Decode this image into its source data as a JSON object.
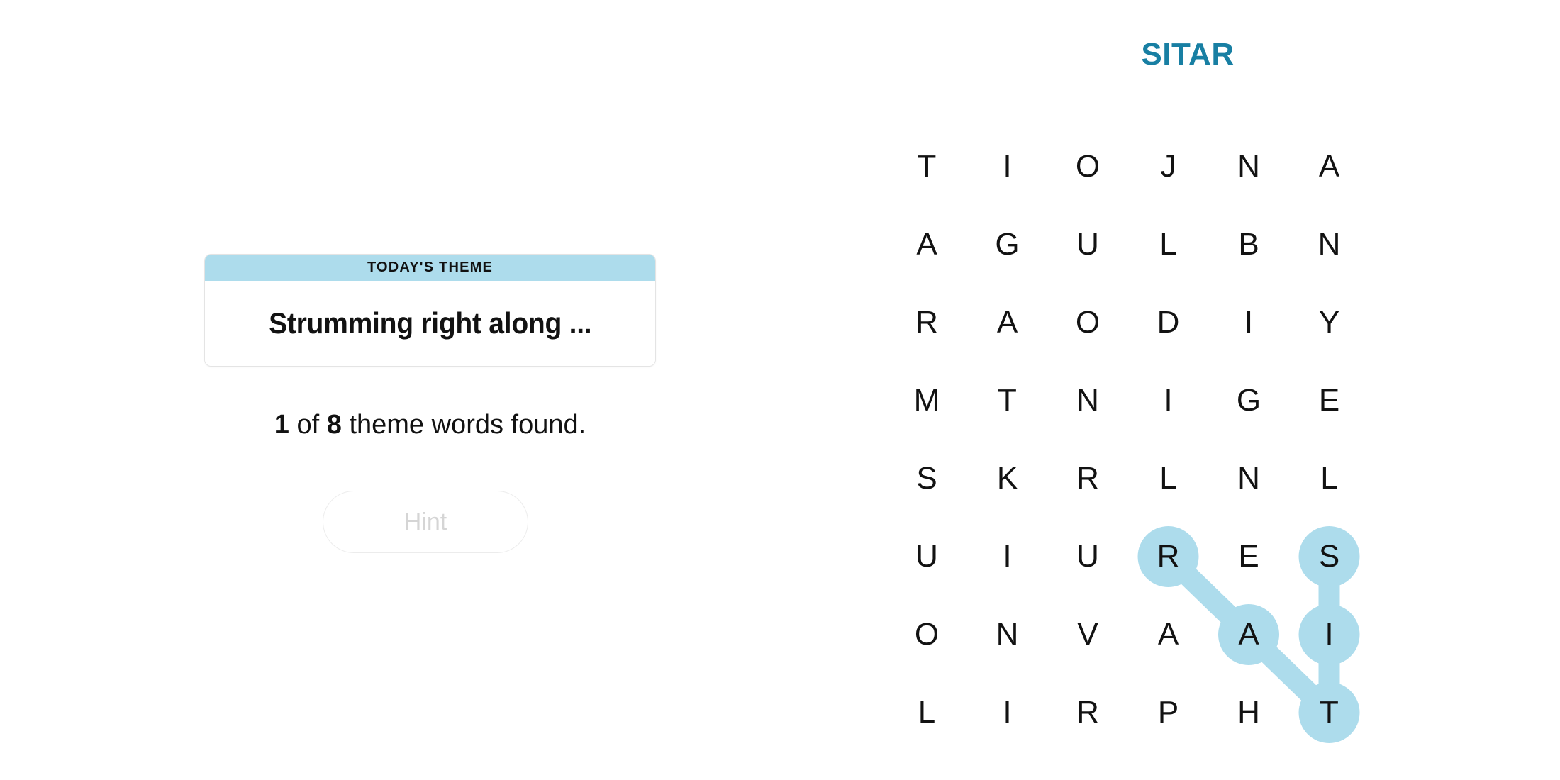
{
  "puzzle": {
    "title": "SITAR",
    "title_color": "#187FA3",
    "highlight_color": "#ADDCEC",
    "rows": 8,
    "cols": 6,
    "grid": [
      [
        "T",
        "I",
        "O",
        "J",
        "N",
        "A"
      ],
      [
        "A",
        "G",
        "U",
        "L",
        "B",
        "N"
      ],
      [
        "R",
        "A",
        "O",
        "D",
        "I",
        "Y"
      ],
      [
        "M",
        "T",
        "N",
        "I",
        "G",
        "E"
      ],
      [
        "S",
        "K",
        "R",
        "L",
        "N",
        "L"
      ],
      [
        "U",
        "I",
        "U",
        "R",
        "E",
        "S"
      ],
      [
        "O",
        "N",
        "V",
        "A",
        "A",
        "I"
      ],
      [
        "L",
        "I",
        "R",
        "P",
        "H",
        "T"
      ]
    ],
    "found_word": {
      "word": "SITAR",
      "path": [
        {
          "row": 5,
          "col": 5,
          "letter": "S"
        },
        {
          "row": 6,
          "col": 5,
          "letter": "I"
        },
        {
          "row": 7,
          "col": 5,
          "letter": "T"
        },
        {
          "row": 6,
          "col": 4,
          "letter": "A"
        },
        {
          "row": 5,
          "col": 3,
          "letter": "R"
        }
      ]
    }
  },
  "theme_card": {
    "header_label": "TODAY'S THEME",
    "theme_text": "Strumming right along ...",
    "header_bg": "#ADDCEC"
  },
  "progress": {
    "found_count": "1",
    "connector": " of ",
    "total_count": "8",
    "suffix": " theme words found."
  },
  "hint_button": {
    "label": "Hint",
    "disabled": true
  }
}
